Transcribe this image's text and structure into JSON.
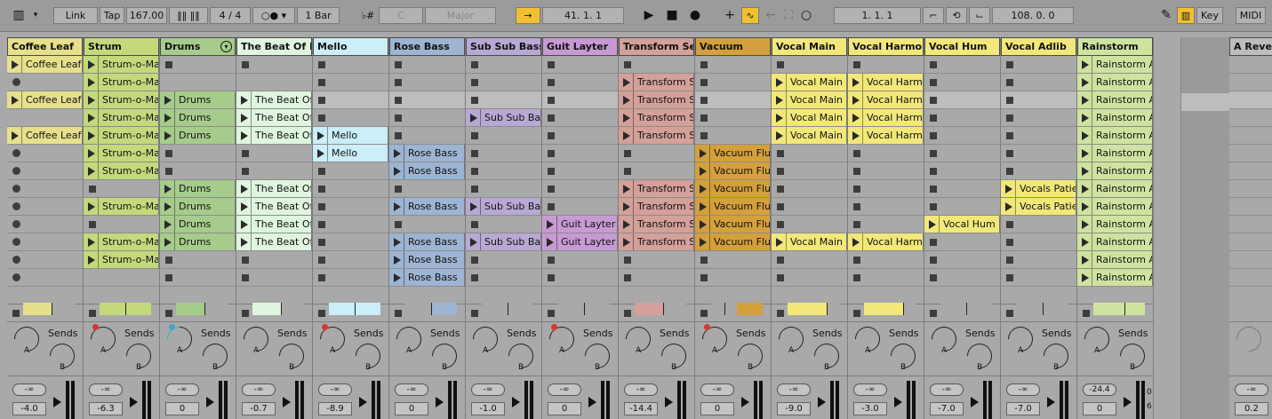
{
  "toolbar": {
    "link": "Link",
    "tap": "Tap",
    "tempo": "167.00",
    "time_signature": "4 / 4",
    "quantize": "1 Bar",
    "key_root": "C",
    "scale": "Major",
    "arrangement_position": "41.  1.  1",
    "loop_start": "1.  1.  1",
    "loop_length": "108.  0.  0",
    "key_label": "Key",
    "midi_label": "MIDI"
  },
  "tracks": [
    {
      "name": "Coffee Leaf",
      "color": "#e6e08c",
      "fold": false,
      "send_red": false,
      "send_cyan": false,
      "vol": "-4.0",
      "clips": [
        {
          "slot": 0,
          "name": "Coffee Leaf"
        },
        {
          "slot": 2,
          "name": "Coffee Leaf"
        },
        {
          "slot": 4,
          "name": "Coffee Leaf"
        }
      ],
      "stops": [],
      "meter": {
        "fill": 0.55,
        "mark": 0.55
      }
    },
    {
      "name": "Strum",
      "color": "#c3d97c",
      "fold": false,
      "send_red": true,
      "send_cyan": false,
      "vol": "-6.3",
      "clips": [
        {
          "slot": 0,
          "name": "Strum-o-Matic"
        },
        {
          "slot": 1,
          "name": "Strum-o-Matic"
        },
        {
          "slot": 2,
          "name": "Strum-o-Matic"
        },
        {
          "slot": 3,
          "name": "Strum-o-Matic"
        },
        {
          "slot": 4,
          "name": "Strum-o-Matic"
        },
        {
          "slot": 5,
          "name": "Strum-o-Matic"
        },
        {
          "slot": 6,
          "name": "Strum-o-Matic"
        },
        {
          "slot": 8,
          "name": "Strum-o-Matic"
        },
        {
          "slot": 10,
          "name": "Strum-o-Matic"
        },
        {
          "slot": 11,
          "name": "Strum-o-Matic"
        }
      ],
      "stops": [
        7,
        9
      ],
      "meter": {
        "fill": 1.0,
        "mark": 0.5
      }
    },
    {
      "name": "Drums",
      "color": "#a6cc8c",
      "fold": true,
      "send_red": false,
      "send_cyan": true,
      "vol": "0",
      "clips": [
        {
          "slot": 2,
          "name": "Drums"
        },
        {
          "slot": 3,
          "name": "Drums"
        },
        {
          "slot": 4,
          "name": "Drums"
        },
        {
          "slot": 7,
          "name": "Drums"
        },
        {
          "slot": 8,
          "name": "Drums"
        },
        {
          "slot": 9,
          "name": "Drums"
        },
        {
          "slot": 10,
          "name": "Drums"
        }
      ],
      "stops": [
        0,
        5,
        6,
        11,
        12
      ],
      "meter": {
        "fill": 0.55,
        "mark": 0.55
      }
    },
    {
      "name": "The Beat Of H",
      "color": "#dff5df",
      "fold": false,
      "send_red": false,
      "send_cyan": false,
      "vol": "-0.7",
      "clips": [
        {
          "slot": 2,
          "name": "The Beat Of H"
        },
        {
          "slot": 3,
          "name": "The Beat Of H"
        },
        {
          "slot": 4,
          "name": "The Beat Of H"
        },
        {
          "slot": 7,
          "name": "The Beat Of H"
        },
        {
          "slot": 8,
          "name": "The Beat Of H"
        },
        {
          "slot": 9,
          "name": "The Beat Of H"
        },
        {
          "slot": 10,
          "name": "The Beat Of H"
        }
      ],
      "stops": [
        0,
        5,
        6,
        11,
        12
      ],
      "meter": {
        "fill": 0.55,
        "mark": 0.55
      }
    },
    {
      "name": "Mello",
      "color": "#cbeef8",
      "fold": false,
      "send_red": true,
      "send_cyan": false,
      "vol": "-8.9",
      "clips": [
        {
          "slot": 4,
          "name": "Mello"
        },
        {
          "slot": 5,
          "name": "Mello"
        }
      ],
      "stops": [
        0,
        1,
        2,
        3,
        6,
        7,
        8,
        9,
        10,
        11,
        12
      ],
      "meter": {
        "fill": 1.0,
        "mark": 0.5
      }
    },
    {
      "name": "Rose Bass",
      "color": "#9db4d2",
      "fold": false,
      "send_red": false,
      "send_cyan": false,
      "vol": "0",
      "clips": [
        {
          "slot": 5,
          "name": "Rose Bass"
        },
        {
          "slot": 6,
          "name": "Rose Bass"
        },
        {
          "slot": 8,
          "name": "Rose Bass"
        },
        {
          "slot": 10,
          "name": "Rose Bass"
        },
        {
          "slot": 11,
          "name": "Rose Bass"
        },
        {
          "slot": 12,
          "name": "Rose Bass"
        }
      ],
      "stops": [
        0,
        1,
        2,
        3,
        4,
        7,
        9
      ],
      "meter": {
        "fill": 0.5,
        "mark": 0.5,
        "right": true
      }
    },
    {
      "name": "Sub Sub Bass",
      "color": "#b8a8d4",
      "fold": false,
      "send_red": false,
      "send_cyan": false,
      "vol": "-1.0",
      "clips": [
        {
          "slot": 3,
          "name": "Sub Sub Bass"
        },
        {
          "slot": 8,
          "name": "Sub Sub Bass"
        },
        {
          "slot": 10,
          "name": "Sub Sub Bass"
        }
      ],
      "stops": [
        0,
        1,
        2,
        4,
        5,
        6,
        7,
        9,
        11,
        12
      ],
      "meter": {
        "fill": 0,
        "mark": 0.5
      }
    },
    {
      "name": "Guit Layter",
      "color": "#c89ad4",
      "fold": false,
      "send_red": true,
      "send_cyan": false,
      "vol": "0",
      "clips": [
        {
          "slot": 9,
          "name": "Guit Layter"
        },
        {
          "slot": 10,
          "name": "Guit Layter"
        }
      ],
      "stops": [
        0,
        1,
        2,
        3,
        4,
        5,
        6,
        7,
        8,
        11,
        12
      ],
      "meter": {
        "fill": 0,
        "mark": 0.5
      }
    },
    {
      "name": "Transform Se",
      "color": "#d4a09a",
      "fold": false,
      "send_red": false,
      "send_cyan": false,
      "vol": "-14.4",
      "clips": [
        {
          "slot": 1,
          "name": "Transform Se"
        },
        {
          "slot": 2,
          "name": "Transform Se"
        },
        {
          "slot": 3,
          "name": "Transform Se"
        },
        {
          "slot": 4,
          "name": "Transform Se"
        },
        {
          "slot": 7,
          "name": "Transform Se"
        },
        {
          "slot": 8,
          "name": "Transform Se"
        },
        {
          "slot": 9,
          "name": "Transform Se"
        },
        {
          "slot": 10,
          "name": "Transform Se"
        }
      ],
      "stops": [
        0,
        5,
        6,
        11,
        12
      ],
      "meter": {
        "fill": 0.55,
        "mark": 0.55
      }
    },
    {
      "name": "Vacuum",
      "color": "#d4a03c",
      "fold": false,
      "send_red": true,
      "send_cyan": false,
      "vol": "0",
      "clips": [
        {
          "slot": 5,
          "name": "Vacuum Fluffer"
        },
        {
          "slot": 6,
          "name": "Vacuum Fluffer"
        },
        {
          "slot": 7,
          "name": "Vacuum Fluffer"
        },
        {
          "slot": 8,
          "name": "Vacuum Fluffer"
        },
        {
          "slot": 9,
          "name": "Vacuum Fluffer"
        },
        {
          "slot": 10,
          "name": "Vacuum Fluffer"
        }
      ],
      "stops": [
        0,
        1,
        2,
        3,
        4,
        11,
        12
      ],
      "meter": {
        "fill": 0.55,
        "mark": 0.25,
        "right": true
      }
    },
    {
      "name": "Vocal Main",
      "color": "#f2e87a",
      "fold": false,
      "send_red": false,
      "send_cyan": false,
      "vol": "-9.0",
      "clips": [
        {
          "slot": 1,
          "name": "Vocal Main"
        },
        {
          "slot": 2,
          "name": "Vocal Main"
        },
        {
          "slot": 3,
          "name": "Vocal Main"
        },
        {
          "slot": 4,
          "name": "Vocal Main"
        },
        {
          "slot": 10,
          "name": "Vocal Main"
        }
      ],
      "stops": [
        0,
        5,
        6,
        7,
        8,
        9,
        11,
        12
      ],
      "meter": {
        "fill": 0.75,
        "mark": 0.75
      }
    },
    {
      "name": "Vocal Harmon",
      "color": "#f2e87a",
      "fold": false,
      "send_red": false,
      "send_cyan": false,
      "vol": "-3.0",
      "clips": [
        {
          "slot": 1,
          "name": "Vocal Harmony"
        },
        {
          "slot": 2,
          "name": "Vocal Harmony"
        },
        {
          "slot": 3,
          "name": "Vocal Harmony"
        },
        {
          "slot": 4,
          "name": "Vocal Harmony"
        },
        {
          "slot": 10,
          "name": "Vocal Harmony"
        }
      ],
      "stops": [
        0,
        5,
        6,
        7,
        8,
        9,
        11,
        12
      ],
      "meter": {
        "fill": 0.75,
        "mark": 0.75
      }
    },
    {
      "name": "Vocal Hum",
      "color": "#f2e87a",
      "fold": false,
      "send_red": false,
      "send_cyan": false,
      "vol": "-7.0",
      "clips": [
        {
          "slot": 9,
          "name": "Vocal Hum"
        }
      ],
      "stops": [
        0,
        1,
        2,
        3,
        4,
        5,
        6,
        7,
        8,
        10,
        11,
        12
      ],
      "meter": {
        "fill": 0,
        "mark": 0.5
      }
    },
    {
      "name": "Vocal Adlib",
      "color": "#f2e87a",
      "fold": false,
      "send_red": false,
      "send_cyan": false,
      "vol": "-7.0",
      "clips": [
        {
          "slot": 7,
          "name": "Vocals Patience"
        },
        {
          "slot": 8,
          "name": "Vocals Patience"
        }
      ],
      "stops": [
        0,
        1,
        2,
        3,
        4,
        5,
        6,
        9,
        10,
        11,
        12
      ],
      "meter": {
        "fill": 0,
        "mark": 0.5
      }
    },
    {
      "name": "Rainstorm",
      "color": "#cfe3a0",
      "fold": false,
      "send_red": false,
      "send_cyan": false,
      "vol": "0",
      "clips": [
        {
          "slot": 0,
          "name": "Rainstorm Auto"
        },
        {
          "slot": 1,
          "name": "Rainstorm Auto"
        },
        {
          "slot": 2,
          "name": "Rainstorm Auto"
        },
        {
          "slot": 3,
          "name": "Rainstorm Auto"
        },
        {
          "slot": 4,
          "name": "Rainstorm Auto"
        },
        {
          "slot": 5,
          "name": "Rainstorm Auto"
        },
        {
          "slot": 6,
          "name": "Rainstorm Auto"
        },
        {
          "slot": 7,
          "name": "Rainstorm Auto"
        },
        {
          "slot": 8,
          "name": "Rainstorm Auto"
        },
        {
          "slot": 9,
          "name": "Rainstorm Auto"
        },
        {
          "slot": 10,
          "name": "Rainstorm Auto"
        },
        {
          "slot": 11,
          "name": "Rainstorm Auto"
        },
        {
          "slot": 12,
          "name": "Rainstorm Auto"
        }
      ],
      "stops": [],
      "meter": {
        "fill": 1.0,
        "mark": 0.6
      }
    }
  ],
  "slot_count": 13,
  "highlight_slot": 2,
  "dot_tracks": [
    0
  ],
  "dot_slots": [
    1,
    5,
    6,
    7,
    8,
    9,
    10,
    11,
    12
  ],
  "mixer": {
    "pill_label": "-∞",
    "sends_label": "Sends",
    "send_a": "A",
    "send_b": "B",
    "master_vol": "-24.4",
    "master_db_label": "0",
    "master_db_label2": "6"
  },
  "return_track": {
    "name": "A Reverb",
    "vol": "0.2"
  }
}
